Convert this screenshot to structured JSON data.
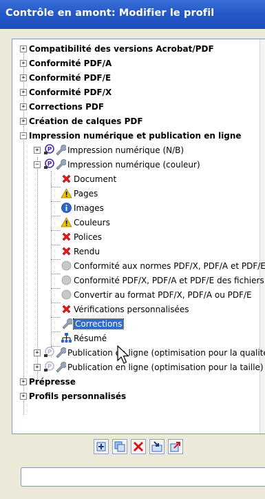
{
  "window": {
    "title": "Contrôle en amont: Modifier le profil"
  },
  "tree": {
    "top_groups": [
      "Compatibilité des versions Acrobat/PDF",
      "Conformité PDF/A",
      "Conformité PDF/E",
      "Conformité PDF/X",
      "Corrections PDF",
      "Création de calques PDF",
      "Impression numérique et publication en ligne"
    ],
    "profiles": {
      "nb": "Impression numérique (N/B)",
      "couleur": "Impression numérique (couleur)",
      "qual": "Publication en ligne (optimisation pour la qualité)",
      "taille": "Publication en ligne (optimisation pour la taille)"
    },
    "children": [
      "Document",
      "Pages",
      "Images",
      "Couleurs",
      "Polices",
      "Rendu",
      "Conformité aux normes PDF/X, PDF/A et PDF/E",
      "Conformité PDF/X, PDF/A et PDF/E des fichiers",
      "Convertir au format PDF/X, PDF/A ou PDF/E",
      "Vérifications personnalisées",
      "Corrections",
      "Résumé"
    ],
    "bottom_groups": [
      "Prépresse",
      "Profils personnalisés"
    ]
  },
  "colors": {
    "title_bar": "#2559c7",
    "selection": "#316ac5",
    "error": "#e02020",
    "warning": "#f2c200",
    "info": "#2a66d0"
  },
  "toolbar": {
    "buttons": [
      {
        "name": "new-icon"
      },
      {
        "name": "duplicate-icon"
      },
      {
        "name": "delete-icon"
      },
      {
        "name": "import-icon"
      },
      {
        "name": "export-icon"
      }
    ]
  },
  "status": {
    "text": ""
  }
}
